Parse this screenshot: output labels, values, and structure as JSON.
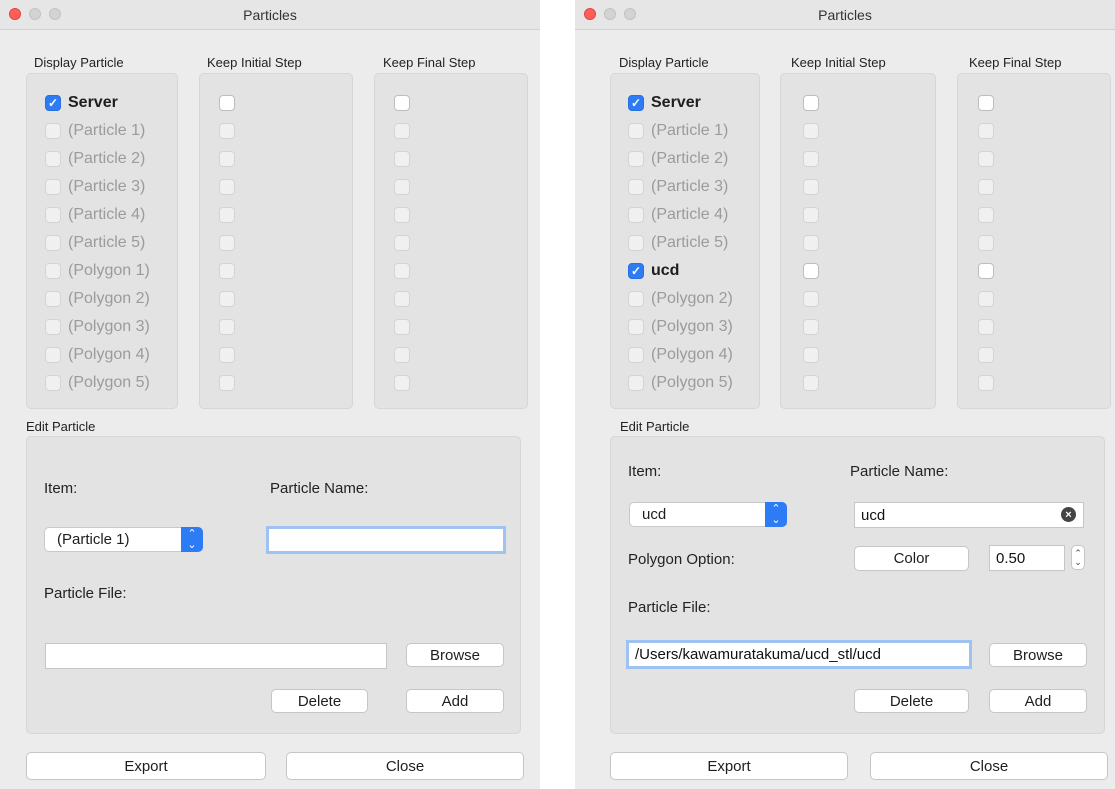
{
  "left": {
    "title": "Particles",
    "headers": [
      "Display Particle",
      "Keep Initial Step",
      "Keep Final Step"
    ],
    "rows": [
      {
        "label": "Server",
        "checked": true,
        "active": true
      },
      {
        "label": "(Particle 1)",
        "checked": false,
        "active": false
      },
      {
        "label": "(Particle 2)",
        "checked": false,
        "active": false
      },
      {
        "label": "(Particle 3)",
        "checked": false,
        "active": false
      },
      {
        "label": "(Particle 4)",
        "checked": false,
        "active": false
      },
      {
        "label": "(Particle 5)",
        "checked": false,
        "active": false
      },
      {
        "label": "(Polygon 1)",
        "checked": false,
        "active": false
      },
      {
        "label": "(Polygon 2)",
        "checked": false,
        "active": false
      },
      {
        "label": "(Polygon 3)",
        "checked": false,
        "active": false
      },
      {
        "label": "(Polygon 4)",
        "checked": false,
        "active": false
      },
      {
        "label": "(Polygon 5)",
        "checked": false,
        "active": false
      }
    ],
    "edit": {
      "section": "Edit Particle",
      "item_label": "Item:",
      "item_value": "(Particle 1)",
      "name_label": "Particle Name:",
      "name_value": "",
      "file_label": "Particle File:",
      "file_value": "",
      "browse": "Browse",
      "delete": "Delete",
      "add": "Add"
    },
    "export": "Export",
    "close": "Close"
  },
  "right": {
    "title": "Particles",
    "headers": [
      "Display Particle",
      "Keep Initial Step",
      "Keep Final Step"
    ],
    "rows": [
      {
        "label": "Server",
        "checked": true,
        "active": true
      },
      {
        "label": "(Particle 1)",
        "checked": false,
        "active": false
      },
      {
        "label": "(Particle 2)",
        "checked": false,
        "active": false
      },
      {
        "label": "(Particle 3)",
        "checked": false,
        "active": false
      },
      {
        "label": "(Particle 4)",
        "checked": false,
        "active": false
      },
      {
        "label": "(Particle 5)",
        "checked": false,
        "active": false
      },
      {
        "label": "ucd",
        "checked": true,
        "active": true
      },
      {
        "label": "(Polygon 2)",
        "checked": false,
        "active": false
      },
      {
        "label": "(Polygon 3)",
        "checked": false,
        "active": false
      },
      {
        "label": "(Polygon 4)",
        "checked": false,
        "active": false
      },
      {
        "label": "(Polygon 5)",
        "checked": false,
        "active": false
      }
    ],
    "edit": {
      "section": "Edit Particle",
      "item_label": "Item:",
      "item_value": "ucd",
      "name_label": "Particle Name:",
      "name_value": "ucd",
      "polygon_label": "Polygon Option:",
      "color_button": "Color",
      "opacity_value": "0.50",
      "file_label": "Particle File:",
      "file_value": "/Users/kawamuratakuma/ucd_stl/ucd",
      "browse": "Browse",
      "delete": "Delete",
      "add": "Add"
    },
    "export": "Export",
    "close": "Close"
  },
  "colors": {
    "accent": "#2d7cf6",
    "disabled_text": "#9b9b9b",
    "window_bg": "#ececec",
    "group_bg": "#e3e3e3"
  }
}
